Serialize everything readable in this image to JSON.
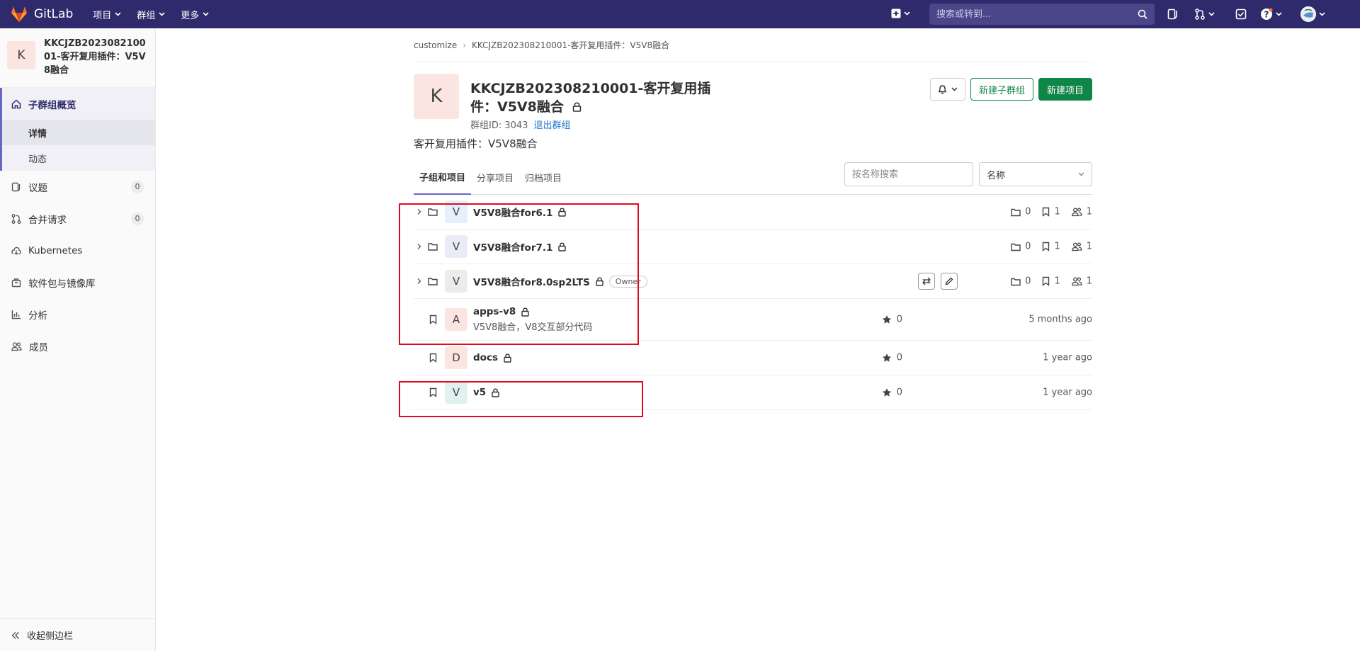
{
  "navbar": {
    "brand": "GitLab",
    "menus": [
      {
        "label": "项目"
      },
      {
        "label": "群组"
      },
      {
        "label": "更多"
      }
    ],
    "search_placeholder": "搜索或转到..."
  },
  "sidebar": {
    "avatar_letter": "K",
    "title": "KKCJZB202308210001-客开复用插件：V5V8融合",
    "overview_label": "子群组概览",
    "sub_items": [
      {
        "label": "详情"
      },
      {
        "label": "动态"
      }
    ],
    "items": [
      {
        "label": "议题",
        "count": "0"
      },
      {
        "label": "合并请求",
        "count": "0"
      },
      {
        "label": "Kubernetes"
      },
      {
        "label": "软件包与镜像库"
      },
      {
        "label": "分析"
      },
      {
        "label": "成员"
      }
    ],
    "collapse_label": "收起侧边栏"
  },
  "breadcrumb": [
    {
      "label": "customize"
    },
    {
      "label": "KKCJZB202308210001-客开复用插件：V5V8融合"
    }
  ],
  "group": {
    "avatar_letter": "K",
    "title": "KKCJZB202308210001-客开复用插件：V5V8融合",
    "id_label": "群组ID: 3043",
    "leave_label": "退出群组",
    "description": "客开复用插件：V5V8融合"
  },
  "actions": {
    "new_subgroup": "新建子群组",
    "new_project": "新建项目"
  },
  "tabs": [
    {
      "label": "子组和项目"
    },
    {
      "label": "分享项目"
    },
    {
      "label": "归档项目"
    }
  ],
  "filter": {
    "placeholder": "按名称搜索",
    "sort_label": "名称"
  },
  "subgroups": [
    {
      "letter": "V",
      "name": "V5V8融合for6.1",
      "avatar_color": "#e6f0fb",
      "subgroups": "0",
      "projects": "1",
      "members": "1"
    },
    {
      "letter": "V",
      "name": "V5V8融合for7.1",
      "avatar_color": "#ebebf7",
      "subgroups": "0",
      "projects": "1",
      "members": "1"
    },
    {
      "letter": "V",
      "name": "V5V8融合for8.0sp2LTS",
      "avatar_color": "#ececec",
      "badge": "Owner",
      "subgroups": "0",
      "projects": "1",
      "members": "1"
    }
  ],
  "projects": [
    {
      "letter": "A",
      "name": "apps-v8",
      "description": "V5V8融合，V8交互部分代码",
      "avatar_color": "#fbe5e1",
      "stars": "0",
      "updated": "5 months ago"
    },
    {
      "letter": "D",
      "name": "docs",
      "avatar_color": "#fbe5e1",
      "stars": "0",
      "updated": "1 year ago"
    },
    {
      "letter": "V",
      "name": "v5",
      "avatar_color": "#e1f2ee",
      "stars": "0",
      "updated": "1 year ago"
    }
  ],
  "colors": {
    "navbar": "#2f2a6b",
    "accent": "#6666c4",
    "primary_button": "#108548",
    "highlight": "#e00b1f",
    "link": "#1f75cb"
  }
}
